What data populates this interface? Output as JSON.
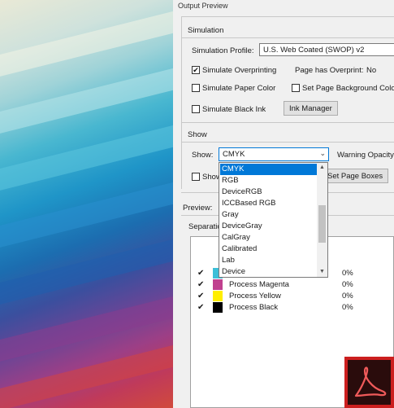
{
  "dialog": {
    "title": "Output Preview",
    "simulation": {
      "heading": "Simulation",
      "profile_label": "Simulation Profile:",
      "profile_value": "U.S. Web Coated (SWOP) v2",
      "simulate_overprinting": {
        "label": "Simulate Overprinting",
        "checked": true
      },
      "page_has_overprint_label": "Page has Overprint:",
      "page_has_overprint_value": "No",
      "simulate_paper_color": {
        "label": "Simulate Paper Color",
        "checked": false
      },
      "set_page_background": {
        "label": "Set Page Background Color",
        "checked": false
      },
      "simulate_black_ink": {
        "label": "Simulate Black Ink",
        "checked": false
      },
      "ink_manager_button": "Ink Manager"
    },
    "show_section": {
      "heading": "Show",
      "show_label": "Show:",
      "show_value": "CMYK",
      "warning_opacity_label": "Warning Opacity",
      "show_checkbox_label": "Show",
      "set_page_boxes_button": "Set Page Boxes",
      "options": [
        "CMYK",
        "RGB",
        "DeviceRGB",
        "ICCBased RGB",
        "Gray",
        "DeviceGray",
        "CalGray",
        "Calibrated",
        "Lab",
        "Device"
      ],
      "selected_index": 0
    },
    "preview_label": "Preview:",
    "separations_label": "Separations",
    "separations": [
      {
        "checked": true,
        "color": "#3cbfd8",
        "name": "",
        "percent": "0%"
      },
      {
        "checked": true,
        "color": "#c0418f",
        "name": "Process Magenta",
        "percent": "0%"
      },
      {
        "checked": true,
        "color": "#ffee00",
        "name": "Process Yellow",
        "percent": "0%"
      },
      {
        "checked": true,
        "color": "#000000",
        "name": "Process Black",
        "percent": "0%"
      }
    ]
  },
  "icons": {
    "check": "✔",
    "chevron_down": "⌄",
    "scroll_up": "▲",
    "scroll_down": "▼",
    "logo": "adobe-acrobat-icon"
  },
  "colors": {
    "accent": "#0078d7",
    "logo_red": "#cc1f1f"
  }
}
